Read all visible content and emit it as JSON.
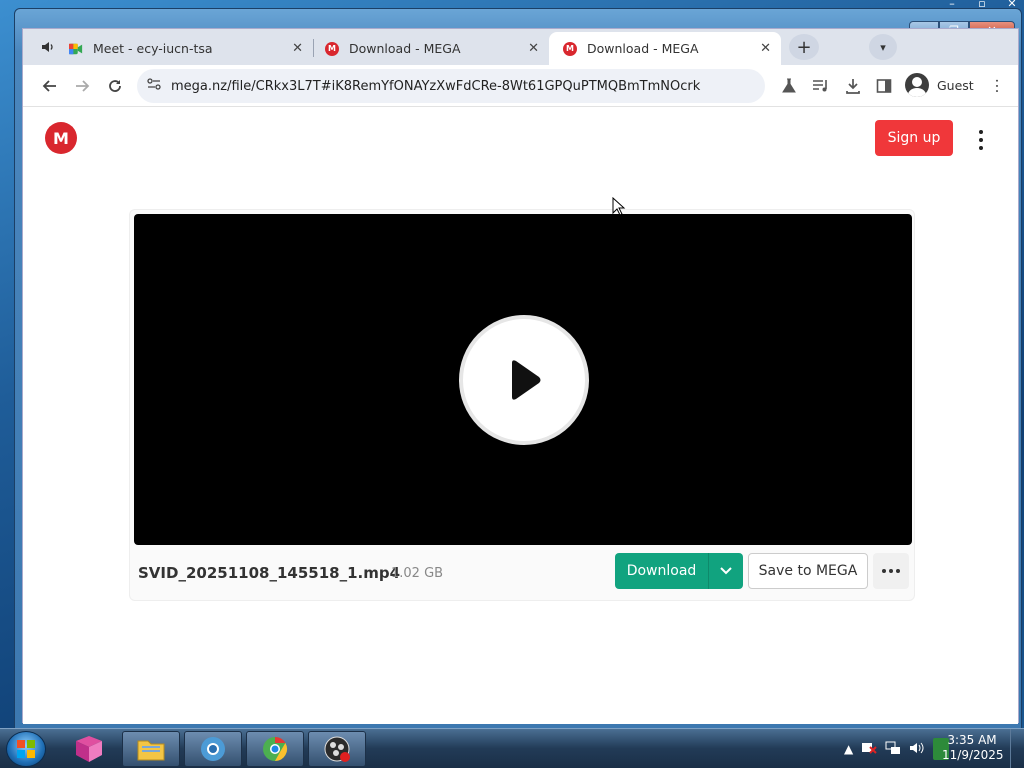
{
  "browser": {
    "tabs": [
      {
        "title": "Meet - ecy-iucn-tsa",
        "favicon": "google-meet-icon",
        "audio": true
      },
      {
        "title": "Download - MEGA",
        "favicon": "mega-icon"
      },
      {
        "title": "Download - MEGA",
        "favicon": "mega-icon",
        "active": true
      }
    ],
    "url": "mega.nz/file/CRkx3L7T#iK8RemYfONAYzXwFdCRe-8Wt61GPQuPTMQBmTmNOcrk",
    "profile_label": "Guest"
  },
  "page": {
    "logo_letter": "M",
    "signup_label": "Sign up",
    "file": {
      "name": "SVID_20251108_145518_1.mp4",
      "size": "1.02 GB"
    },
    "download_label": "Download",
    "save_label": "Save to MEGA"
  },
  "taskbar": {
    "time": "3:35 AM",
    "date": "11/9/2025"
  },
  "colors": {
    "mega_red": "#d9272e",
    "signup_red": "#f0373a",
    "download_green": "#11a37f"
  }
}
